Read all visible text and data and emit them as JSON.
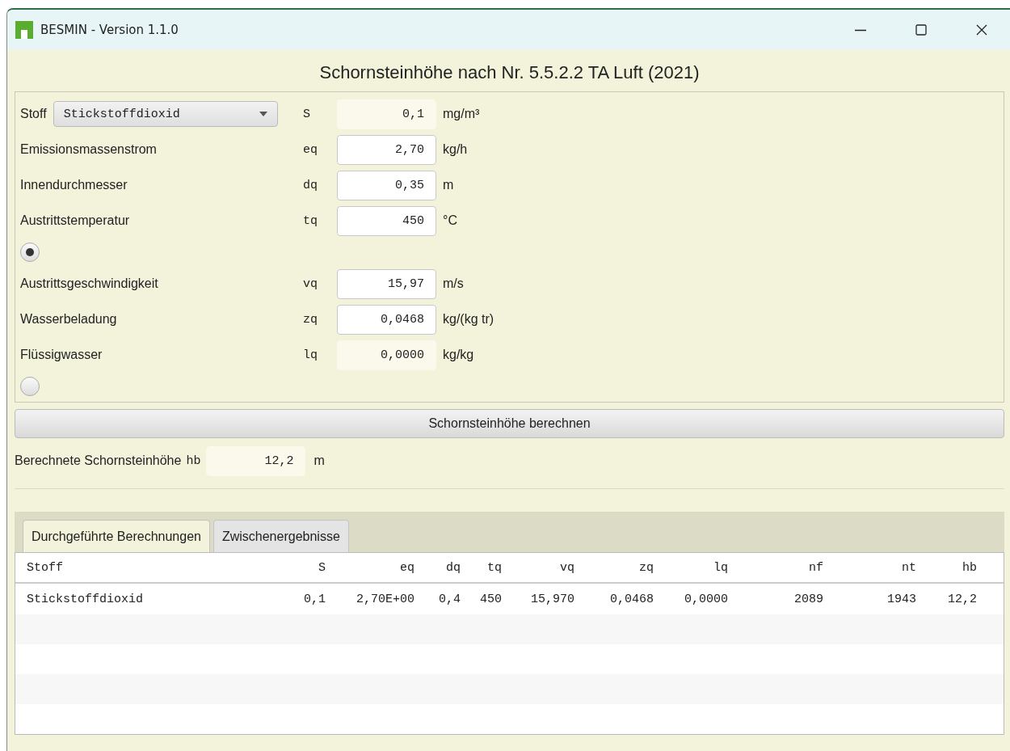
{
  "window": {
    "title": "BESMIN - Version 1.1.0"
  },
  "heading": "Schornsteinhöhe nach Nr. 5.5.2.2 TA Luft (2021)",
  "form": {
    "substance_label": "Stoff",
    "substance_value": "Stickstoffdioxid",
    "rows": [
      {
        "kind": "field",
        "label": "",
        "symbol": "S",
        "value": "0,1",
        "unit": "mg/m³",
        "editable": false
      },
      {
        "kind": "field",
        "label": "Emissionsmassenstrom",
        "symbol": "eq",
        "value": "2,70",
        "unit": "kg/h",
        "editable": true
      },
      {
        "kind": "field",
        "label": "Innendurchmesser",
        "symbol": "dq",
        "value": "0,35",
        "unit": "m",
        "editable": true
      },
      {
        "kind": "field",
        "label": "Austrittstemperatur",
        "symbol": "tq",
        "value": "450",
        "unit": "°C",
        "editable": true
      },
      {
        "kind": "radio",
        "selected": true
      },
      {
        "kind": "field",
        "label": "Austrittsgeschwindigkeit",
        "symbol": "vq",
        "value": "15,97",
        "unit": "m/s",
        "editable": true
      },
      {
        "kind": "field",
        "label": "Wasserbeladung",
        "symbol": "zq",
        "value": "0,0468",
        "unit": "kg/(kg tr)",
        "editable": true
      },
      {
        "kind": "field",
        "label": "Flüssigwasser",
        "symbol": "lq",
        "value": "0,0000",
        "unit": "kg/kg",
        "editable": false
      },
      {
        "kind": "radio",
        "selected": false
      }
    ]
  },
  "calculate_button": "Schornsteinhöhe berechnen",
  "result": {
    "label": "Berechnete Schornsteinhöhe",
    "symbol": "hb",
    "value": "12,2",
    "unit": "m"
  },
  "tabs": [
    {
      "label": "Durchgeführte Berechnungen",
      "selected": true
    },
    {
      "label": "Zwischenergebnisse",
      "selected": false
    }
  ],
  "table": {
    "columns": [
      "Stoff",
      "S",
      "eq",
      "dq",
      "tq",
      "vq",
      "zq",
      "lq",
      "nf",
      "nt",
      "hb"
    ],
    "rows": [
      [
        "Stickstoffdioxid",
        "0,1",
        "2,70E+00",
        "0,4",
        "450",
        "15,970",
        "0,0468",
        "0,0000",
        "2089",
        "1943",
        "12,2"
      ]
    ]
  }
}
